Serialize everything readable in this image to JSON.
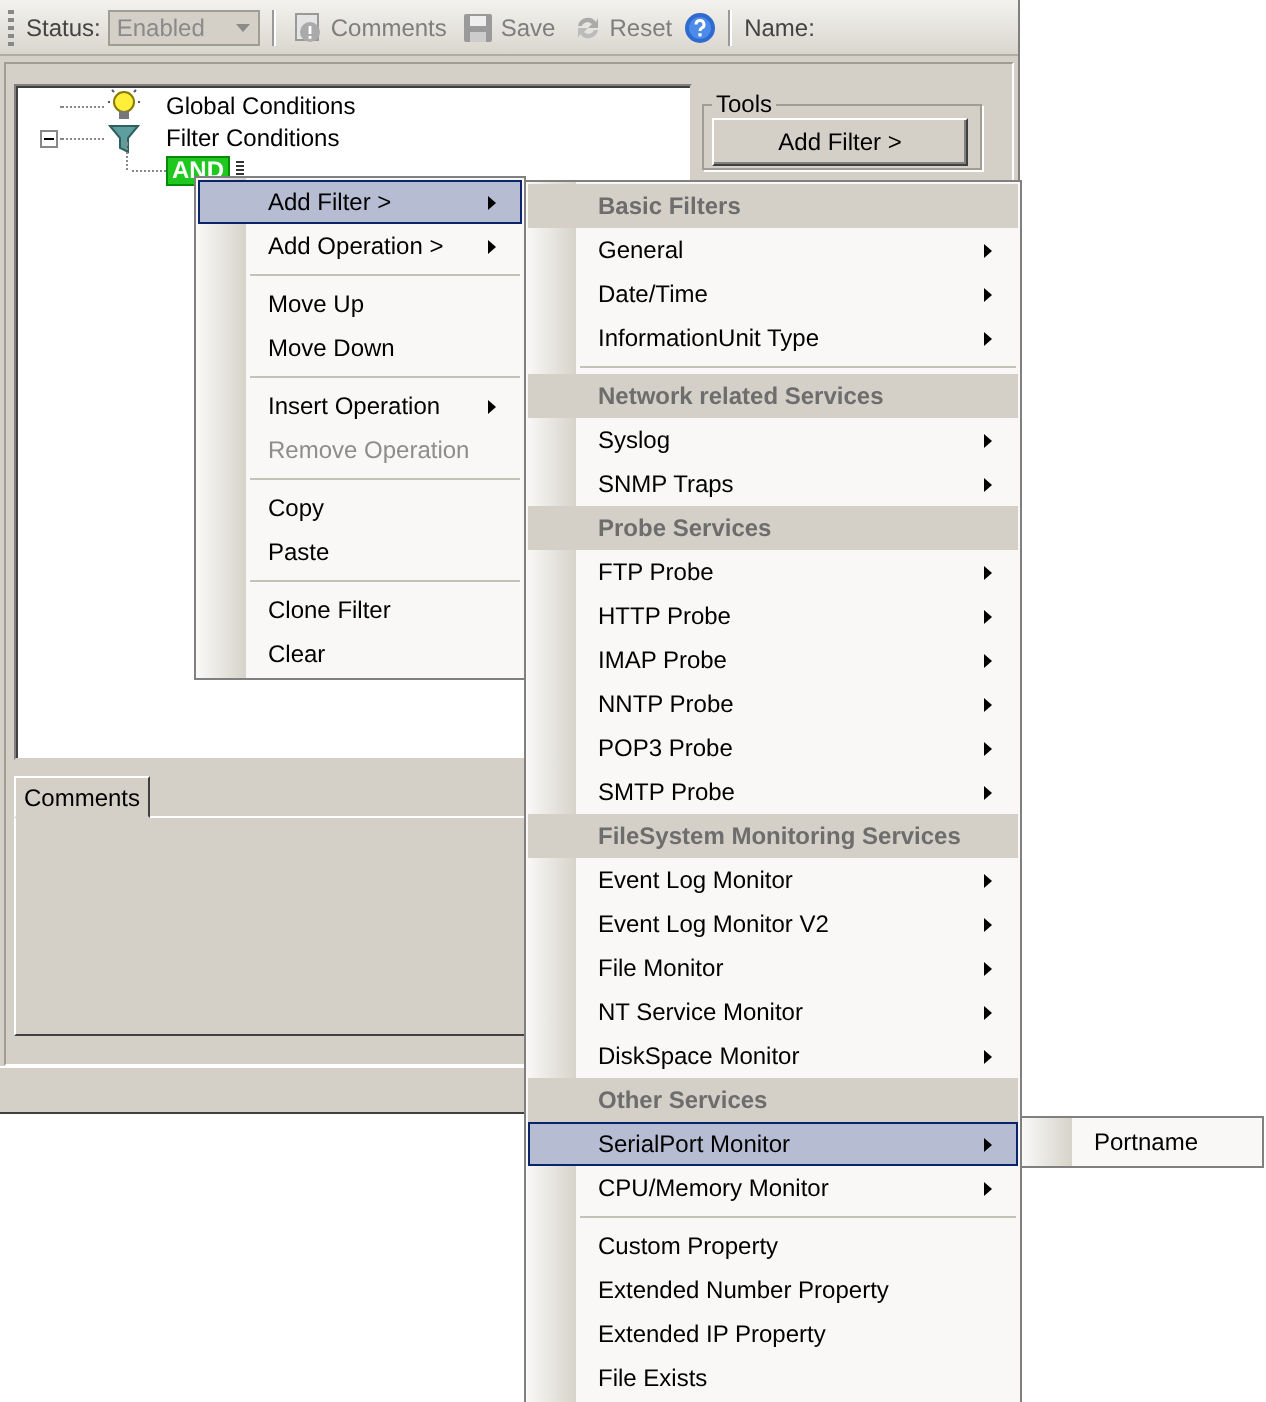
{
  "toolbar": {
    "status_label": "Status:",
    "status_value": "Enabled",
    "status_disabled": true,
    "buttons": [
      {
        "kind": "comments",
        "label": "Comments",
        "disabled": true
      },
      {
        "kind": "save",
        "label": "Save",
        "disabled": true
      },
      {
        "kind": "reset",
        "label": "Reset",
        "disabled": true
      },
      {
        "kind": "help"
      }
    ],
    "name_label": "Name:"
  },
  "tree": [
    {
      "kind": "bulb",
      "label": "Global Conditions"
    },
    {
      "kind": "funnel",
      "label": "Filter Conditions",
      "expanded": true,
      "children": [
        {
          "kind": "and",
          "label": "AND"
        }
      ]
    }
  ],
  "tools": {
    "title": "Tools",
    "button": "Add Filter >"
  },
  "tabs": [
    {
      "label": "Comments",
      "selected": true
    }
  ],
  "context_menu": [
    {
      "kind": "item",
      "label": "Add Filter >",
      "submenu": true,
      "selected": true
    },
    {
      "kind": "item",
      "label": "Add Operation >",
      "submenu": true,
      "selected": false
    },
    {
      "kind": "separator"
    },
    {
      "kind": "item",
      "label": "Move Up",
      "selected": false
    },
    {
      "kind": "item",
      "label": "Move Down",
      "selected": false
    },
    {
      "kind": "separator"
    },
    {
      "kind": "item",
      "label": "Insert Operation",
      "submenu": true,
      "selected": false
    },
    {
      "kind": "item",
      "label": "Remove Operation",
      "disabled": true,
      "selected": false
    },
    {
      "kind": "separator"
    },
    {
      "kind": "item",
      "label": "Copy",
      "selected": false
    },
    {
      "kind": "item",
      "label": "Paste",
      "selected": false
    },
    {
      "kind": "separator"
    },
    {
      "kind": "item",
      "label": "Clone Filter",
      "selected": false
    },
    {
      "kind": "item",
      "label": "Clear",
      "selected": false
    }
  ],
  "filter_menu": [
    {
      "kind": "header",
      "label": "Basic Filters"
    },
    {
      "kind": "item",
      "label": "General",
      "submenu": true,
      "selected": false
    },
    {
      "kind": "item",
      "label": "Date/Time",
      "submenu": true,
      "selected": false
    },
    {
      "kind": "item",
      "label": "InformationUnit Type",
      "submenu": true,
      "selected": false
    },
    {
      "kind": "separator"
    },
    {
      "kind": "header",
      "label": "Network related Services"
    },
    {
      "kind": "item",
      "label": "Syslog",
      "submenu": true,
      "selected": false
    },
    {
      "kind": "item",
      "label": "SNMP Traps",
      "submenu": true,
      "selected": false
    },
    {
      "kind": "header",
      "label": "Probe Services"
    },
    {
      "kind": "item",
      "label": "FTP Probe",
      "submenu": true,
      "selected": false
    },
    {
      "kind": "item",
      "label": "HTTP Probe",
      "submenu": true,
      "selected": false
    },
    {
      "kind": "item",
      "label": "IMAP Probe",
      "submenu": true,
      "selected": false
    },
    {
      "kind": "item",
      "label": "NNTP Probe",
      "submenu": true,
      "selected": false
    },
    {
      "kind": "item",
      "label": "POP3 Probe",
      "submenu": true,
      "selected": false
    },
    {
      "kind": "item",
      "label": "SMTP Probe",
      "submenu": true,
      "selected": false
    },
    {
      "kind": "header",
      "label": "FileSystem Monitoring Services"
    },
    {
      "kind": "item",
      "label": "Event Log Monitor",
      "submenu": true,
      "selected": false
    },
    {
      "kind": "item",
      "label": "Event Log Monitor V2",
      "submenu": true,
      "selected": false
    },
    {
      "kind": "item",
      "label": "File Monitor",
      "submenu": true,
      "selected": false
    },
    {
      "kind": "item",
      "label": "NT Service Monitor",
      "submenu": true,
      "selected": false
    },
    {
      "kind": "item",
      "label": "DiskSpace Monitor",
      "submenu": true,
      "selected": false
    },
    {
      "kind": "header",
      "label": "Other Services"
    },
    {
      "kind": "item",
      "label": "SerialPort Monitor",
      "submenu": true,
      "selected": true
    },
    {
      "kind": "item",
      "label": "CPU/Memory Monitor",
      "submenu": true,
      "selected": false
    },
    {
      "kind": "separator"
    },
    {
      "kind": "item",
      "label": "Custom Property",
      "selected": false
    },
    {
      "kind": "item",
      "label": "Extended Number Property",
      "selected": false
    },
    {
      "kind": "item",
      "label": "Extended IP Property",
      "selected": false
    },
    {
      "kind": "item",
      "label": "File Exists",
      "selected": false
    }
  ],
  "serialport_menu": [
    {
      "kind": "item",
      "label": "Portname",
      "selected": false
    }
  ]
}
